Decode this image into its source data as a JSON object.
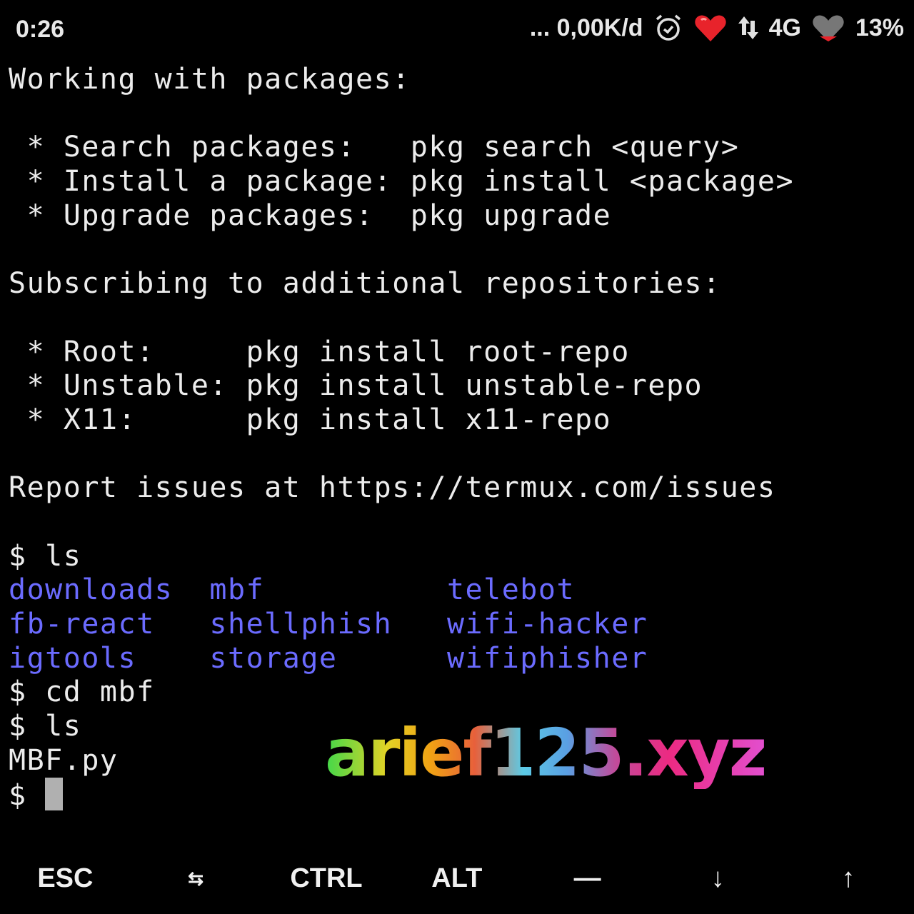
{
  "status_bar": {
    "time": "0:26",
    "network_speed": "... 0,00K/d",
    "network_type": "4G",
    "battery": "13%",
    "icons": [
      "alarm-icon",
      "heart-signal-icon",
      "data-arrows-icon",
      "heart-battery-icon"
    ]
  },
  "terminal": {
    "lines": [
      {
        "text": "Working with packages:"
      },
      {
        "text": ""
      },
      {
        "text": " * Search packages:   pkg search <query>"
      },
      {
        "text": " * Install a package: pkg install <package>"
      },
      {
        "text": " * Upgrade packages:  pkg upgrade"
      },
      {
        "text": ""
      },
      {
        "text": "Subscribing to additional repositories:"
      },
      {
        "text": ""
      },
      {
        "text": " * Root:     pkg install root-repo"
      },
      {
        "text": " * Unstable: pkg install unstable-repo"
      },
      {
        "text": " * X11:      pkg install x11-repo"
      },
      {
        "text": ""
      },
      {
        "text": "Report issues at https://termux.com/issues"
      },
      {
        "text": ""
      },
      {
        "text": "$ ls"
      },
      {
        "text": "downloads  mbf          telebot",
        "color": "blue"
      },
      {
        "text": "fb-react   shellphish   wifi-hacker",
        "color": "blue"
      },
      {
        "text": "igtools    storage      wifiphisher",
        "color": "blue"
      },
      {
        "text": "$ cd mbf"
      },
      {
        "text": "$ ls"
      },
      {
        "text": "MBF.py"
      }
    ],
    "prompt": "$ ",
    "colors": {
      "text": "#ececec",
      "directory": "#6b6bff",
      "background": "#000000"
    }
  },
  "watermark": "arief125.xyz",
  "extra_keys": [
    "ESC",
    "⇆",
    "CTRL",
    "ALT",
    "—",
    "↓",
    "↑"
  ]
}
